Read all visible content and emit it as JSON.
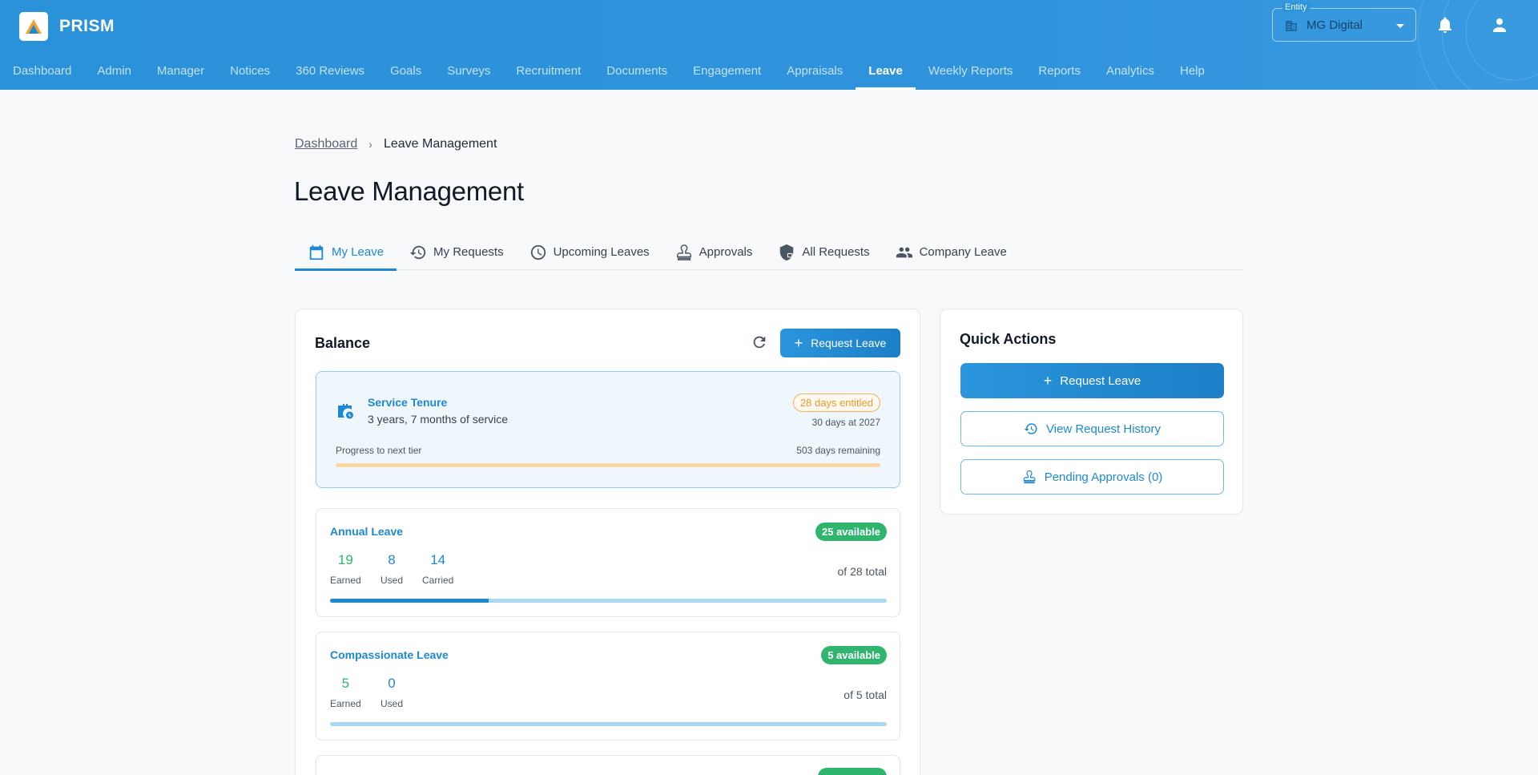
{
  "app": {
    "name": "PRISM"
  },
  "entity": {
    "label": "Entity",
    "value": "MG Digital"
  },
  "nav": [
    {
      "label": "Dashboard"
    },
    {
      "label": "Admin"
    },
    {
      "label": "Manager"
    },
    {
      "label": "Notices"
    },
    {
      "label": "360 Reviews"
    },
    {
      "label": "Goals"
    },
    {
      "label": "Surveys"
    },
    {
      "label": "Recruitment"
    },
    {
      "label": "Documents"
    },
    {
      "label": "Engagement"
    },
    {
      "label": "Appraisals"
    },
    {
      "label": "Leave",
      "active": true
    },
    {
      "label": "Weekly Reports"
    },
    {
      "label": "Reports"
    },
    {
      "label": "Analytics"
    },
    {
      "label": "Help"
    }
  ],
  "breadcrumb": {
    "parent": "Dashboard",
    "separator": "›",
    "current": "Leave Management"
  },
  "page": {
    "title": "Leave Management"
  },
  "tabs": [
    {
      "label": "My Leave",
      "icon": "calendar-icon",
      "active": true
    },
    {
      "label": "My Requests",
      "icon": "history-icon"
    },
    {
      "label": "Upcoming Leaves",
      "icon": "clock-icon"
    },
    {
      "label": "Approvals",
      "icon": "stamp-icon"
    },
    {
      "label": "All Requests",
      "icon": "shield-lock-icon"
    },
    {
      "label": "Company Leave",
      "icon": "people-icon"
    }
  ],
  "balance": {
    "title": "Balance",
    "request_label": "Request Leave",
    "tenure": {
      "title": "Service Tenure",
      "service": "3 years, 7 months of service",
      "entitled_badge": "28 days entitled",
      "next_tier": "30 days at 2027",
      "progress_label": "Progress to next tier",
      "remaining": "503 days remaining",
      "progress": 0
    },
    "leaves": [
      {
        "title": "Annual Leave",
        "badge": "25 available",
        "earned": "19",
        "earned_label": "Earned",
        "used": "8",
        "used_label": "Used",
        "carried": "14",
        "carried_label": "Carried",
        "total": "of 28 total",
        "used_fraction": 0.285
      },
      {
        "title": "Compassionate Leave",
        "badge": "5 available",
        "earned": "5",
        "earned_label": "Earned",
        "used": "0",
        "used_label": "Used",
        "total": "of 5 total",
        "used_fraction": 0
      }
    ]
  },
  "quick_actions": {
    "title": "Quick Actions",
    "request_label": "Request Leave",
    "history_label": "View Request History",
    "approvals_label": "Pending Approvals (0)"
  },
  "colors": {
    "brand": "#2a92d9",
    "accent": "#1e88d3",
    "success": "#2fb56e",
    "warning": "#e79a2e"
  }
}
